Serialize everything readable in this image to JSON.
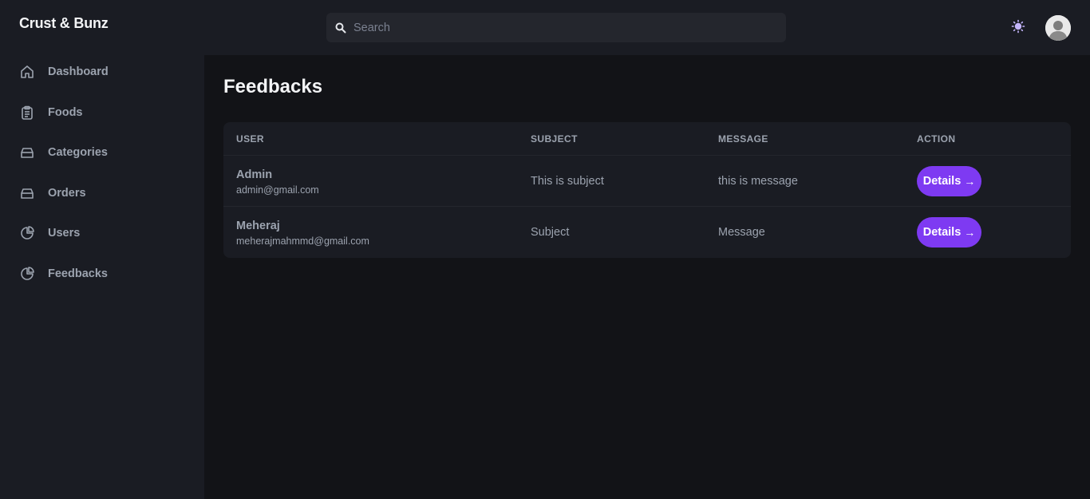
{
  "app": {
    "brand": "Crust & Bunz"
  },
  "sidebar": {
    "items": [
      {
        "label": "Dashboard",
        "icon": "home-icon"
      },
      {
        "label": "Foods",
        "icon": "clipboard-icon"
      },
      {
        "label": "Categories",
        "icon": "tray-icon"
      },
      {
        "label": "Orders",
        "icon": "tray-icon"
      },
      {
        "label": "Users",
        "icon": "pie-chart-icon"
      },
      {
        "label": "Feedbacks",
        "icon": "pie-chart-icon"
      }
    ]
  },
  "header": {
    "search_placeholder": "Search",
    "theme_icon": "sun-icon",
    "avatar_icon": "user-avatar"
  },
  "main": {
    "title": "Feedbacks",
    "table": {
      "columns": [
        "USER",
        "SUBJECT",
        "MESSAGE",
        "ACTION"
      ],
      "rows": [
        {
          "name": "Admin",
          "email": "admin@gmail.com",
          "subject": "This is subject",
          "message": "this is message",
          "action": "Details",
          "action_arrow": "→"
        },
        {
          "name": "Meheraj",
          "email": "meherajmahmmd@gmail.com",
          "subject": "Subject",
          "message": "Message",
          "action": "Details",
          "action_arrow": "→"
        }
      ]
    }
  },
  "colors": {
    "background": "#121317",
    "panel": "#1a1c23",
    "accent": "#7e3af2",
    "text_muted": "#9ca3af"
  }
}
